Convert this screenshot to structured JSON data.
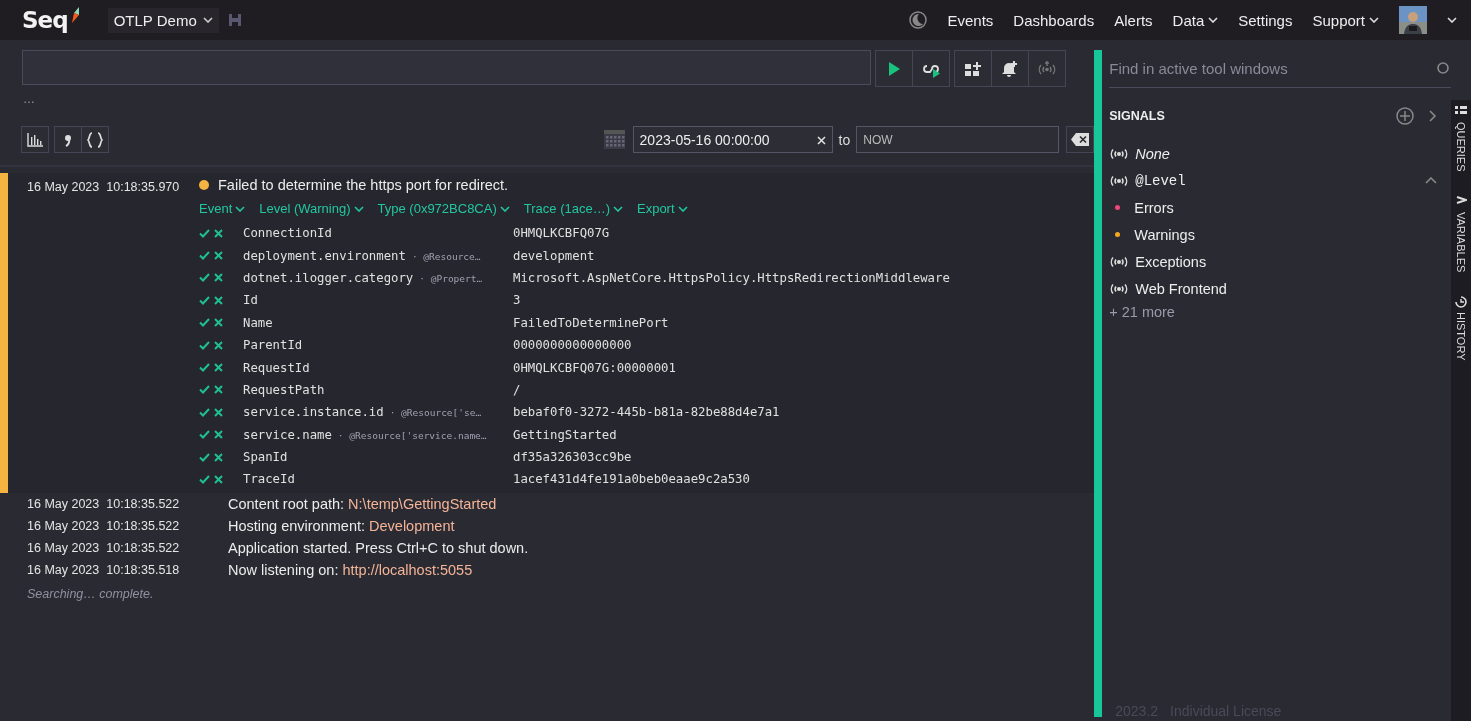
{
  "topbar": {
    "logo": "Seq",
    "workspace": "OTLP Demo",
    "nav": [
      {
        "label": "Events",
        "dropdown": false
      },
      {
        "label": "Dashboards",
        "dropdown": false
      },
      {
        "label": "Alerts",
        "dropdown": false
      },
      {
        "label": "Data",
        "dropdown": true
      },
      {
        "label": "Settings",
        "dropdown": false
      },
      {
        "label": "Support",
        "dropdown": true
      }
    ]
  },
  "query": {
    "status": "…"
  },
  "range": {
    "from": "2023-05-16 00:00:00",
    "to_label": "to",
    "to_placeholder": "NOW"
  },
  "events": [
    {
      "kind": "expanded",
      "date": "16 May 2023",
      "time": "10:18:35.970",
      "color": "#f5b342",
      "message": [
        {
          "kind": "text",
          "text": "Failed to determine the https port for redirect."
        }
      ],
      "actions": [
        "Event",
        "Level (Warning)",
        "Type (0x972BC8CA)",
        "Trace (1ace…)",
        "Export"
      ],
      "properties": [
        {
          "name": "ConnectionId",
          "value": "0HMQLKCBFQ07G"
        },
        {
          "name": "deployment.environment",
          "path": "· @Resource…",
          "value": "development"
        },
        {
          "name": "dotnet.ilogger.category",
          "path": "· @Propert…",
          "value": "Microsoft.AspNetCore.HttpsPolicy.HttpsRedirectionMiddleware"
        },
        {
          "name": "Id",
          "value": "3"
        },
        {
          "name": "Name",
          "value": "FailedToDeterminePort"
        },
        {
          "name": "ParentId",
          "value": "0000000000000000"
        },
        {
          "name": "RequestId",
          "value": "0HMQLKCBFQ07G:00000001"
        },
        {
          "name": "RequestPath",
          "value": "/"
        },
        {
          "name": "service.instance.id",
          "path": "· @Resource['se…",
          "value": "bebaf0f0-3272-445b-b81a-82be88d4e7a1"
        },
        {
          "name": "service.name",
          "path": "· @Resource['service.name…",
          "value": "GettingStarted"
        },
        {
          "name": "SpanId",
          "value": "df35a326303cc9be"
        },
        {
          "name": "TraceId",
          "value": "1acef431d4fe191a0beb0eaae9c2a530"
        }
      ]
    },
    {
      "kind": "collapsed",
      "date": "16 May 2023",
      "time": "10:18:35.522",
      "message": [
        {
          "kind": "text",
          "text": "Content root path: "
        },
        {
          "kind": "value",
          "text": "N:\\temp\\GettingStarted"
        }
      ]
    },
    {
      "kind": "collapsed",
      "date": "16 May 2023",
      "time": "10:18:35.522",
      "message": [
        {
          "kind": "text",
          "text": "Hosting environment: "
        },
        {
          "kind": "value",
          "text": "Development"
        }
      ]
    },
    {
      "kind": "collapsed",
      "date": "16 May 2023",
      "time": "10:18:35.522",
      "message": [
        {
          "kind": "text",
          "text": "Application started. Press Ctrl+C to shut down."
        }
      ]
    },
    {
      "kind": "collapsed",
      "date": "16 May 2023",
      "time": "10:18:35.518",
      "message": [
        {
          "kind": "text",
          "text": "Now listening on: "
        },
        {
          "kind": "value",
          "text": "http://localhost:5055"
        }
      ]
    }
  ],
  "search_status": "Searching… complete.",
  "tools": {
    "search_placeholder": "Find in active tool windows",
    "title": "SIGNALS",
    "signals": [
      {
        "kind": "none",
        "label": "None"
      },
      {
        "kind": "group",
        "label": "@Level",
        "expanded": true,
        "children": [
          {
            "label": "Errors",
            "color": "#f0467a"
          },
          {
            "label": "Warnings",
            "color": "#f5a623"
          }
        ]
      },
      {
        "kind": "signal",
        "label": "Exceptions"
      },
      {
        "kind": "signal",
        "label": "Web Frontend"
      }
    ],
    "more": "+ 21 more"
  },
  "tool_tabs": [
    {
      "kind": "queries",
      "label": "QUERIES"
    },
    {
      "kind": "variables",
      "label": "VARIABLES"
    },
    {
      "kind": "history",
      "label": "HISTORY"
    }
  ],
  "footer": {
    "version": "2023.2",
    "license": "Individual License"
  }
}
